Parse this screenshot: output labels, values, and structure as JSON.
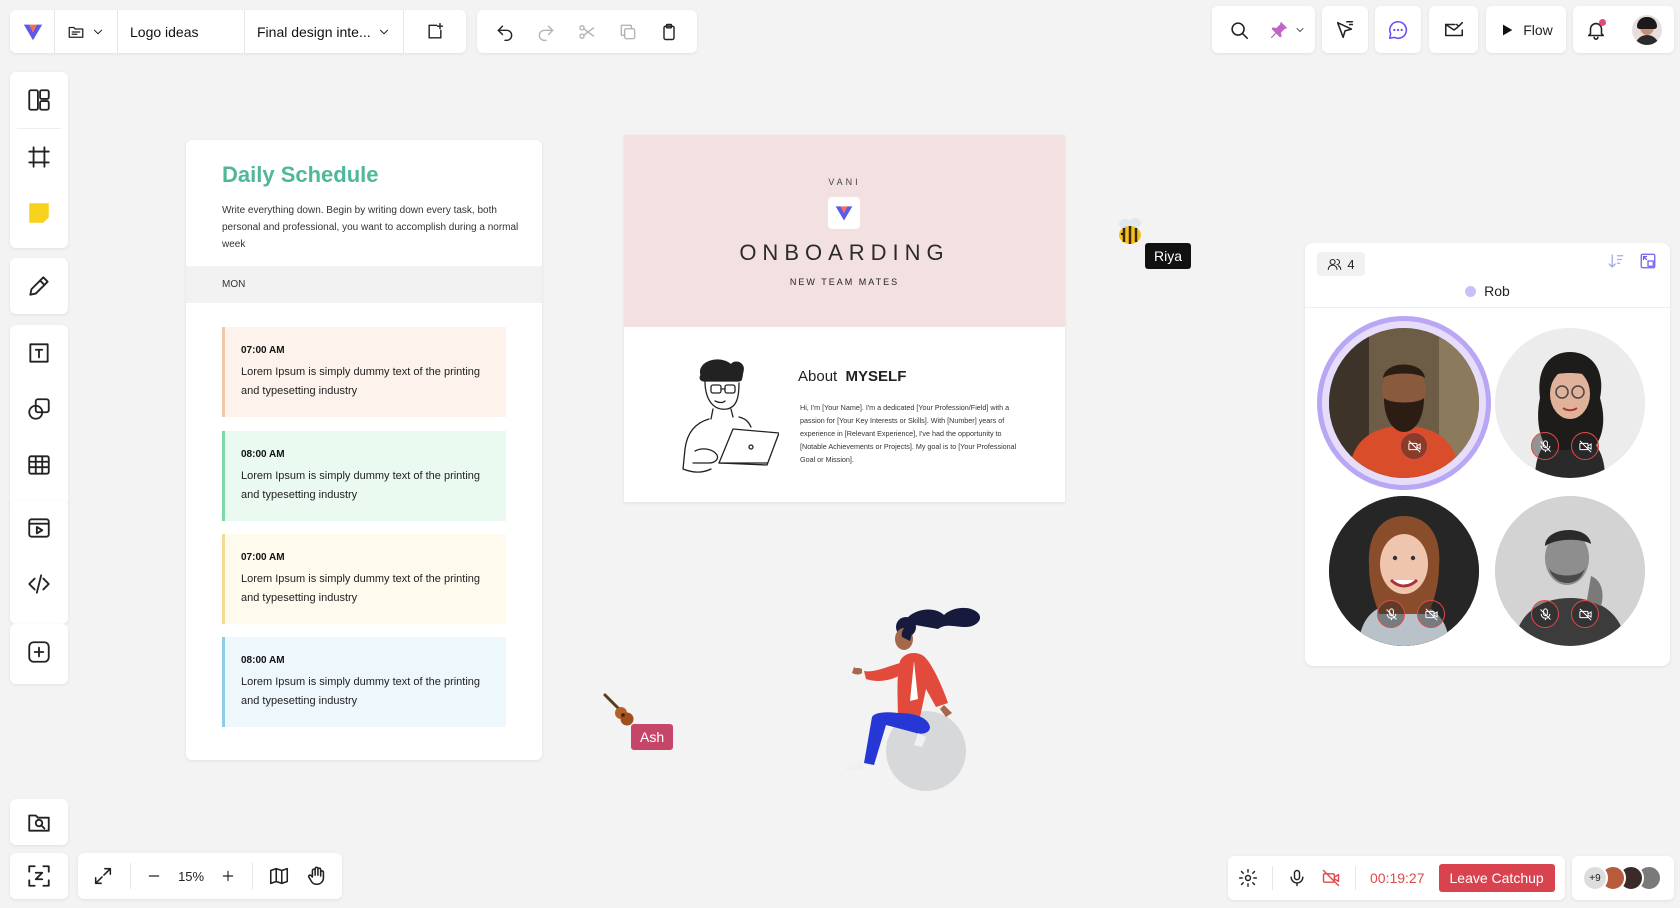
{
  "toolbar": {
    "file_name": "Logo ideas",
    "design_name": "Final design inte...",
    "flow_label": "Flow"
  },
  "schedule": {
    "title": "Daily Schedule",
    "intro": "Write everything down. Begin by writing down every task, both personal and professional, you want to accomplish during a normal week",
    "day": "MON",
    "slots": [
      {
        "time": "07:00 AM",
        "text": "Lorem Ipsum is simply dummy text of the printing and typesetting industry",
        "bg": "#fdf3ec",
        "bar": "#f2c9a8"
      },
      {
        "time": "08:00 AM",
        "text": "Lorem Ipsum is simply dummy text of the printing and typesetting industry",
        "bg": "#eafaf1",
        "bar": "#7fd8a8"
      },
      {
        "time": "07:00 AM",
        "text": "Lorem Ipsum is simply dummy text of the printing and typesetting industry",
        "bg": "#fefaee",
        "bar": "#f1dc95"
      },
      {
        "time": "08:00 AM",
        "text": "Lorem Ipsum is simply dummy text of the printing and typesetting industry",
        "bg": "#eef7fc",
        "bar": "#8fcbea"
      }
    ]
  },
  "onboarding": {
    "brand": "VANI",
    "title": "ONBOARDING",
    "subtitle": "NEW TEAM MATES",
    "about_prefix": "About",
    "about_bold": "MYSELF",
    "about_body": "Hi, I'm [Your Name]. I'm a dedicated [Your Profession/Field] with a passion for [Your Key Interests or Skills]. With [Number] years of experience in [Relevant Experience], I've had the opportunity to [Notable Achievements or Projects]. My goal is to [Your Professional Goal or Mission]."
  },
  "cursors": {
    "riya": "Riya",
    "ash": "Ash"
  },
  "video": {
    "participant_count": "4",
    "speaker": "Rob"
  },
  "zoom": {
    "level": "15%"
  },
  "call": {
    "timer": "00:19:27",
    "leave_label": "Leave Catchup",
    "more_participants": "+9"
  },
  "colors": {
    "accent_green": "#4fb79a",
    "leave_red": "#d9434f",
    "riya_tag": "#111111",
    "ash_tag": "#c6466a",
    "speaker_ring": "#b9a6f5",
    "timer_red": "#e04a4a"
  }
}
